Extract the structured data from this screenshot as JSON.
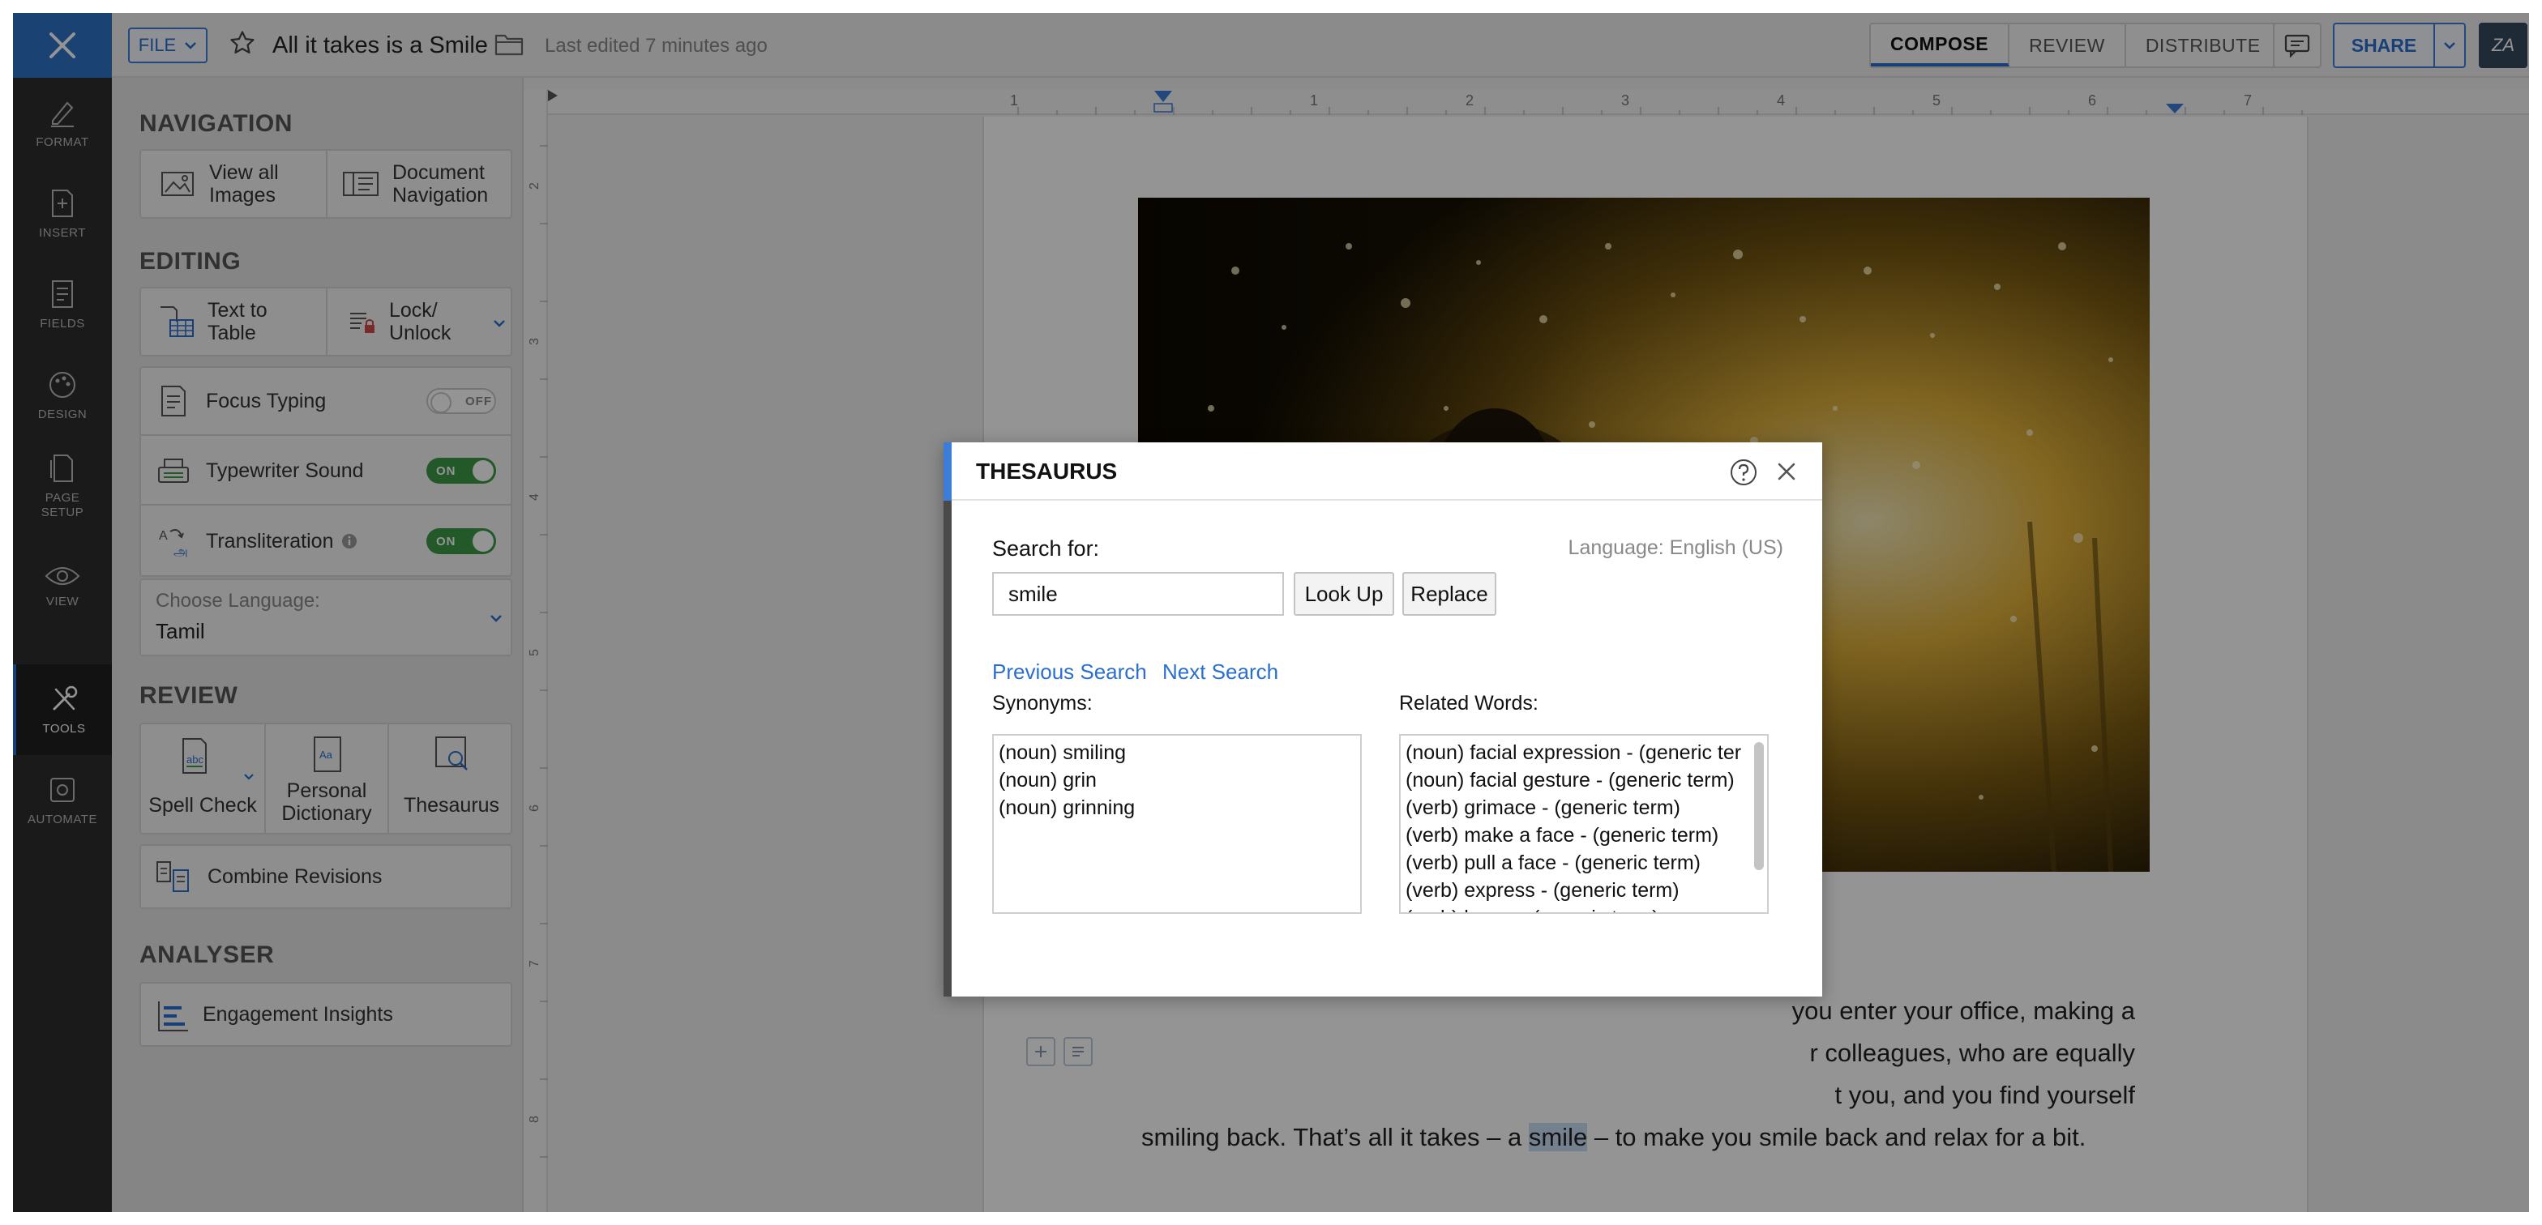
{
  "header": {
    "file_label": "FILE",
    "doc_title": "All it takes is a Smile",
    "last_edited": "Last edited 7 minutes ago",
    "tabs": [
      {
        "label": "COMPOSE",
        "active": true
      },
      {
        "label": "REVIEW",
        "active": false
      },
      {
        "label": "DISTRIBUTE",
        "active": false
      }
    ],
    "share_label": "SHARE",
    "translit_icon_text": "ZA"
  },
  "rail": {
    "items": [
      {
        "label": "FORMAT",
        "icon": "format-icon"
      },
      {
        "label": "INSERT",
        "icon": "insert-icon"
      },
      {
        "label": "FIELDS",
        "icon": "fields-icon"
      },
      {
        "label": "DESIGN",
        "icon": "design-icon"
      },
      {
        "label": "PAGE SETUP",
        "icon": "page-setup-icon"
      },
      {
        "label": "VIEW",
        "icon": "view-icon"
      },
      {
        "label": "TOOLS",
        "icon": "tools-icon",
        "active": true
      },
      {
        "label": "AUTOMATE",
        "icon": "automate-icon"
      }
    ]
  },
  "panel": {
    "navigation": {
      "title": "NAVIGATION",
      "view_images": "View all Images",
      "doc_nav": "Document Navigation"
    },
    "editing": {
      "title": "EDITING",
      "text_to_table": "Text to Table",
      "lock_unlock": "Lock/ Unlock",
      "focus_typing": "Focus Typing",
      "focus_state": "OFF",
      "typewriter": "Typewriter Sound",
      "typewriter_state": "ON",
      "transliteration": "Transliteration",
      "transliteration_state": "ON",
      "choose_language_label": "Choose Language:",
      "choose_language_value": "Tamil"
    },
    "review": {
      "title": "REVIEW",
      "spell_check": "Spell Check",
      "personal_dictionary": "Personal Dictionary",
      "thesaurus": "Thesaurus",
      "combine_revisions": "Combine Revisions"
    },
    "analyser": {
      "title": "ANALYSER",
      "engagement": "Engagement Insights"
    }
  },
  "document": {
    "body_lines": {
      "l1": "you enter your office, making a",
      "l2": "r colleagues, who are equally",
      "l3": "t you, and you find yourself",
      "l4_pre": "smiling back. That’s all it takes – a ",
      "l4_hl": "smile",
      "l4_post": " – to make you smile back and relax for a bit."
    }
  },
  "thesaurus": {
    "title": "THESAURUS",
    "search_for_label": "Search for:",
    "search_value": "smile",
    "language": "Language: English (US)",
    "look_up": "Look Up",
    "replace": "Replace",
    "prev_search": "Previous Search",
    "next_search": "Next Search",
    "synonyms_label": "Synonyms:",
    "synonyms": [
      "(noun) smiling",
      "(noun) grin",
      "(noun) grinning"
    ],
    "related_label": "Related Words:",
    "related": [
      "(noun) facial expression - (generic ter",
      "(noun) facial gesture - (generic term)",
      "(verb) grimace - (generic term)",
      "(verb) make a face - (generic term)",
      "(verb) pull a face - (generic term)",
      "(verb) express - (generic term)",
      "(verb) beam - (generic term)"
    ]
  }
}
